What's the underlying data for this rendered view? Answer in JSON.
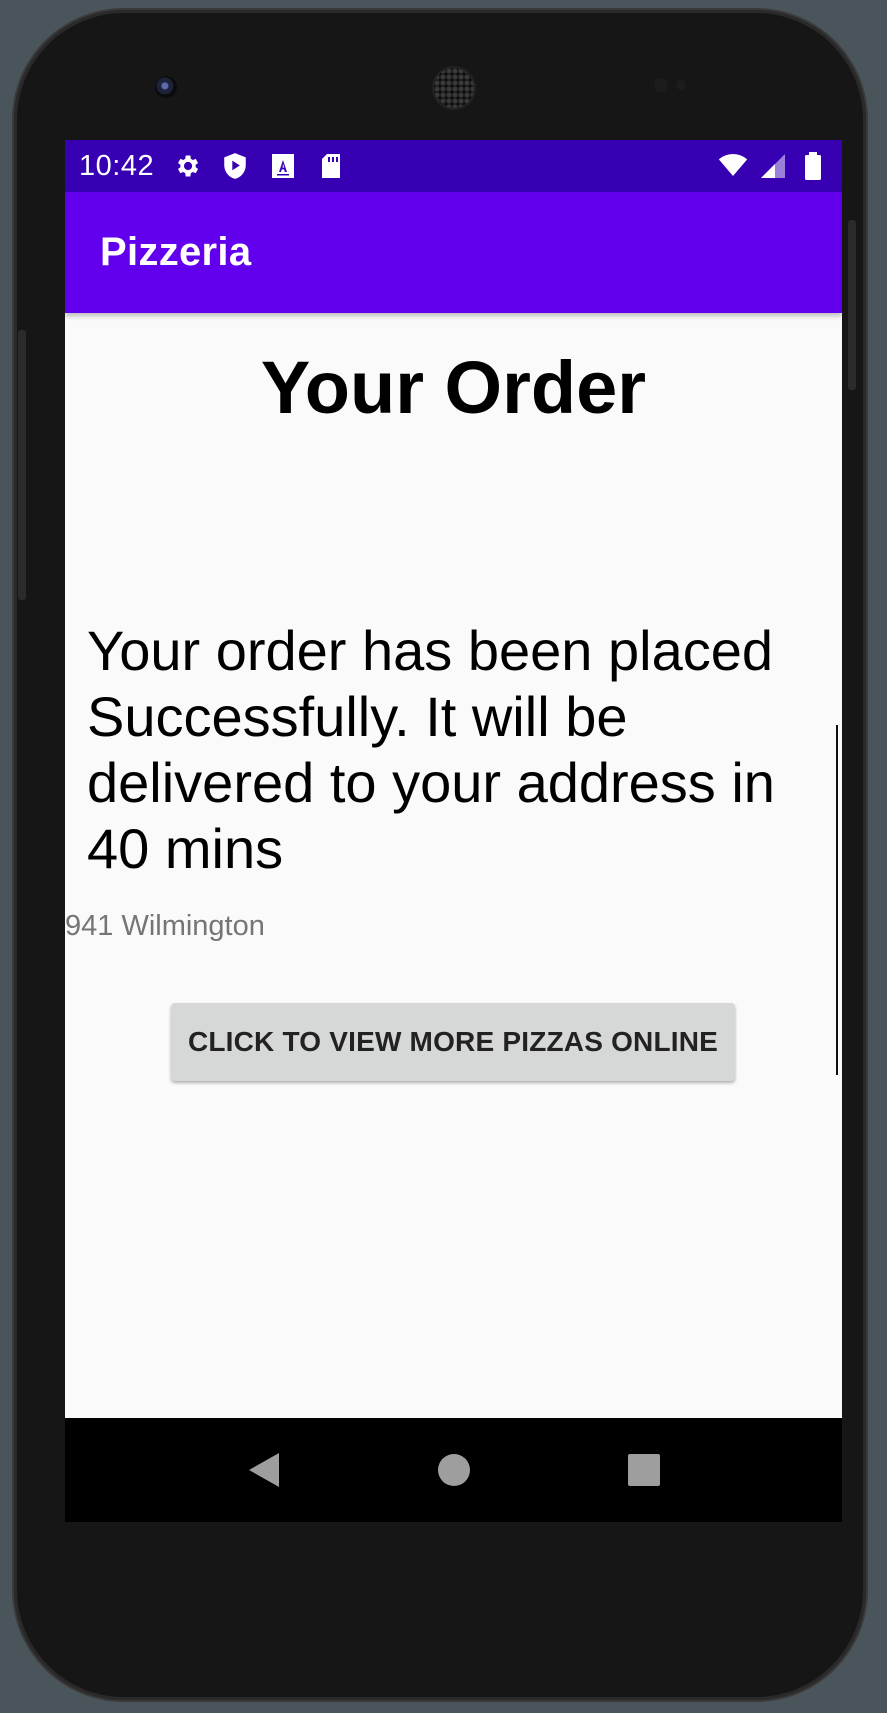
{
  "status_bar": {
    "time": "10:42",
    "left_icons": [
      "settings-icon",
      "shield-play-icon",
      "font-a-icon",
      "sd-card-icon"
    ],
    "right_icons": [
      "wifi-icon",
      "signal-icon",
      "battery-icon"
    ]
  },
  "app_bar": {
    "title": "Pizzeria"
  },
  "main": {
    "heading": "Your Order",
    "message": "Your order has been placed Successfully. It will be delivered to your address in 40 mins",
    "address": "941 Wilmington",
    "button_label": "CLICK TO VIEW MORE PIZZAS ONLINE"
  },
  "nav_bar": {
    "buttons": [
      "back-icon",
      "home-icon",
      "recents-icon"
    ]
  },
  "colors": {
    "status_bar": "#3700b3",
    "app_bar": "#6200ee",
    "background": "#fafafa",
    "button": "#d6d7d7"
  }
}
